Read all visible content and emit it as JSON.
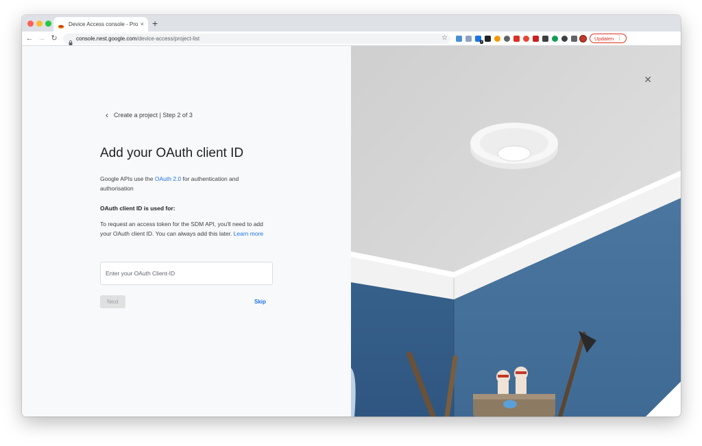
{
  "browser": {
    "tab_title": "Device Access console - Proje",
    "tab_close": "×",
    "new_tab": "+",
    "url_host": "console.nest.google.com",
    "url_path": "/device-access/project-list",
    "extension_badge": "2",
    "update_label": "Updaten"
  },
  "page": {
    "back_label": "Create a project | Step 2 of 3",
    "title": "Add your OAuth client ID",
    "intro_before": "Google APIs use the ",
    "intro_link": "OAuth 2.0",
    "intro_after": " for authentication and authorisation",
    "subheading": "OAuth client ID is used for:",
    "body_text": "To request an access token for the SDM API, you'll need to add your OAuth client ID. You can always add this later. ",
    "learn_more": "Learn more",
    "input_placeholder": "Enter your OAuth Client-ID",
    "next_label": "Next",
    "skip_label": "Skip"
  },
  "colors": {
    "accent": "#1a73e8",
    "wall_blue": "#3f6a93",
    "ceiling": "#d8d8d8"
  }
}
